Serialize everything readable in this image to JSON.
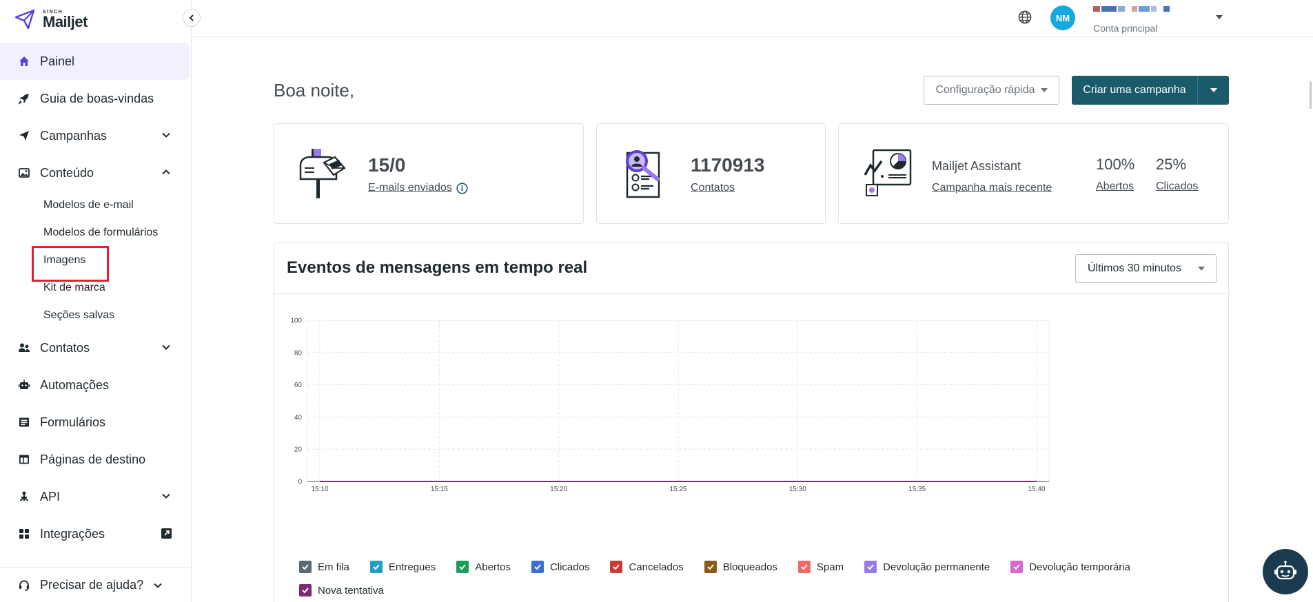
{
  "brand": {
    "small": "SINCH",
    "name": "Mailjet",
    "accent": "#5c3fd6"
  },
  "sidebar": {
    "items": [
      {
        "label": "Painel",
        "icon": "home-icon",
        "active": true
      },
      {
        "label": "Guia de boas-vindas",
        "icon": "rocket-icon"
      },
      {
        "label": "Campanhas",
        "icon": "paper-plane-icon",
        "expandable": "chevron-down-icon"
      },
      {
        "label": "Conteúdo",
        "icon": "image-icon",
        "expandable": "chevron-up-icon"
      },
      {
        "label": "Contatos",
        "icon": "people-icon",
        "expandable": "chevron-down-icon"
      },
      {
        "label": "Automações",
        "icon": "robot-icon"
      },
      {
        "label": "Formulários",
        "icon": "form-icon"
      },
      {
        "label": "Páginas de destino",
        "icon": "layout-icon"
      },
      {
        "label": "API",
        "icon": "network-icon",
        "expandable": "chevron-down-icon"
      },
      {
        "label": "Integrações",
        "icon": "grid-icon",
        "external": "external-link-icon"
      }
    ],
    "content_sub": [
      {
        "label": "Modelos de e-mail"
      },
      {
        "label": "Modelos de formulários"
      },
      {
        "label": "Imagens",
        "highlighted": true
      },
      {
        "label": "Kit de marca"
      },
      {
        "label": "Seções salvas"
      }
    ],
    "help": "Precisar de ajuda?"
  },
  "header": {
    "avatar_initials": "NM",
    "avatar_color": "#19a7e0",
    "account_sub": "Conta principal"
  },
  "main": {
    "greeting": "Boa noite,",
    "quick_config": "Configuração rápida",
    "create_campaign": "Criar uma campanha",
    "cards": {
      "emails": {
        "value": "15/0",
        "label": "E-mails enviados"
      },
      "contacts": {
        "value": "1170913",
        "label": "Contatos"
      },
      "assistant": {
        "title": "Mailjet Assistant",
        "link": "Campanha mais recente",
        "opened_pct": "100%",
        "opened_label": "Abertos",
        "clicked_pct": "25%",
        "clicked_label": "Clicados"
      }
    },
    "events": {
      "title": "Eventos de mensagens em tempo real",
      "range": "Últimos 30 minutos"
    },
    "primary_color": "#195a6b"
  },
  "chart_data": {
    "type": "line",
    "x": [
      "15:10",
      "15:15",
      "15:20",
      "15:25",
      "15:30",
      "15:35",
      "15:40"
    ],
    "ylim": [
      0,
      100
    ],
    "yticks": [
      0,
      20,
      40,
      60,
      80,
      100
    ],
    "grid": true,
    "series": [
      {
        "name": "Em fila",
        "color": "#5a6a74",
        "values": [
          0,
          0,
          0,
          0,
          0,
          0,
          0
        ]
      },
      {
        "name": "Entregues",
        "color": "#1fa0c0",
        "values": [
          0,
          0,
          0,
          0,
          0,
          0,
          0
        ]
      },
      {
        "name": "Abertos",
        "color": "#1a9e5a",
        "values": [
          0,
          0,
          0,
          0,
          0,
          0,
          0
        ]
      },
      {
        "name": "Clicados",
        "color": "#3a6fd0",
        "values": [
          0,
          0,
          0,
          0,
          0,
          0,
          0
        ]
      },
      {
        "name": "Cancelados",
        "color": "#c93a3a",
        "values": [
          0,
          0,
          0,
          0,
          0,
          0,
          0
        ]
      },
      {
        "name": "Bloqueados",
        "color": "#8a5a1a",
        "values": [
          0,
          0,
          0,
          0,
          0,
          0,
          0
        ]
      },
      {
        "name": "Spam",
        "color": "#ee6a6a",
        "values": [
          0,
          0,
          0,
          0,
          0,
          0,
          0
        ]
      },
      {
        "name": "Devolução permanente",
        "color": "#9a7ae8",
        "values": [
          0,
          0,
          0,
          0,
          0,
          0,
          0
        ]
      },
      {
        "name": "Devolução temporária",
        "color": "#d766d0",
        "values": [
          0,
          0,
          0,
          0,
          0,
          0,
          0
        ]
      },
      {
        "name": "Nova tentativa",
        "color": "#7b2a72",
        "values": [
          0,
          0,
          0,
          0,
          0,
          0,
          0
        ]
      }
    ],
    "legend": "bottom"
  }
}
